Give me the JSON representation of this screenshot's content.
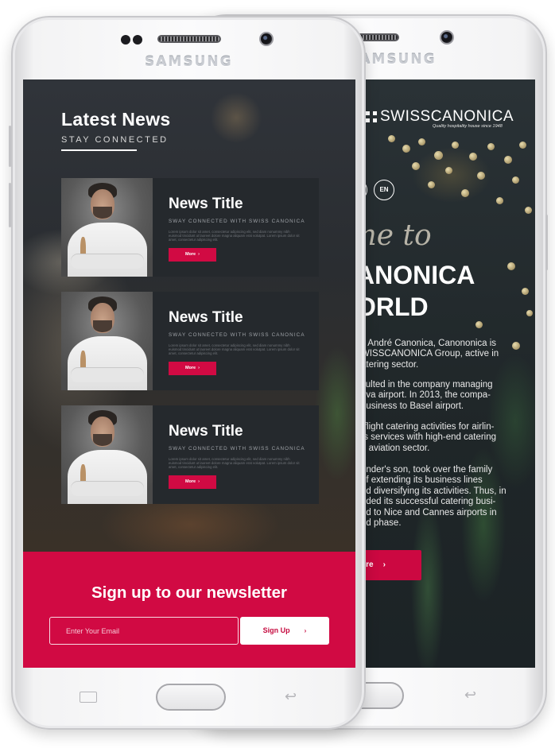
{
  "device": {
    "brand": "SAMSUNG"
  },
  "back_screen": {
    "logo": "SWISSCANONICA",
    "tagline": "Quality hospitality house since 1948",
    "lang": [
      "",
      "EN"
    ],
    "welcome": "ome to",
    "heading_line1": "ANONICA",
    "heading_line2": "ORLD",
    "paragraphs": [
      "y André Canonica, Canononica is\nWISSCANONICA Group, active in\natering sector.",
      "sulted in the company managing\neva airport. In 2013, the compa-\nbusiness to Basel airport.",
      "-flight catering activities for airlin-\nts services with high-end catering\ne aviation sector.",
      "under's son, took over the family\nof extending its business lines\nnd diversifying its activities. Thus, in\nnded its successful catering busi-\nnd to Nice and Cannes airports in\nnd phase."
    ],
    "more_label": "ore",
    "more_icon": "chevron-right-icon"
  },
  "front_screen": {
    "news": {
      "heading": "Latest News",
      "subheading": "STAY CONNECTED",
      "cards": [
        {
          "title": "News Title",
          "tagline": "SWAY CONNECTED WITH SWISS CANONICA",
          "body": "Lorem ipsum dolor sit amet, consectetur adipiscing elit, sed diam nonummy nibh euismod tincidunt ut laoreet dolore magna aliquam erat volutpat. Lorem ipsum dolor sit amet, consectetur adipiscing elit.",
          "more_label": "More",
          "more_icon": "chevron-right-icon"
        },
        {
          "title": "News Title",
          "tagline": "SWAY CONNECTED WITH SWISS CANONICA",
          "body": "Lorem ipsum dolor sit amet, consectetur adipiscing elit, sed diam nonummy nibh euismod tincidunt ut laoreet dolore magna aliquam erat volutpat. Lorem ipsum dolor sit amet, consectetur adipiscing elit.",
          "more_label": "More",
          "more_icon": "chevron-right-icon"
        },
        {
          "title": "News Title",
          "tagline": "SWAY CONNECTED WITH SWISS CANONICA",
          "body": "Lorem ipsum dolor sit amet, consectetur adipiscing elit, sed diam nonummy nibh euismod tincidunt ut laoreet dolore magna aliquam erat volutpat. Lorem ipsum dolor sit amet, consectetur adipiscing elit.",
          "more_label": "More",
          "more_icon": "chevron-right-icon"
        }
      ]
    },
    "newsletter": {
      "title": "Sign up to our newsletter",
      "email_placeholder": "Enter Your Email",
      "email_value": "",
      "button_label": "Sign Up",
      "button_icon": "chevron-right-icon"
    }
  },
  "colors": {
    "accent": "#d10a43",
    "card_bg": "#25292d",
    "screen_bg": "#1f2326"
  }
}
